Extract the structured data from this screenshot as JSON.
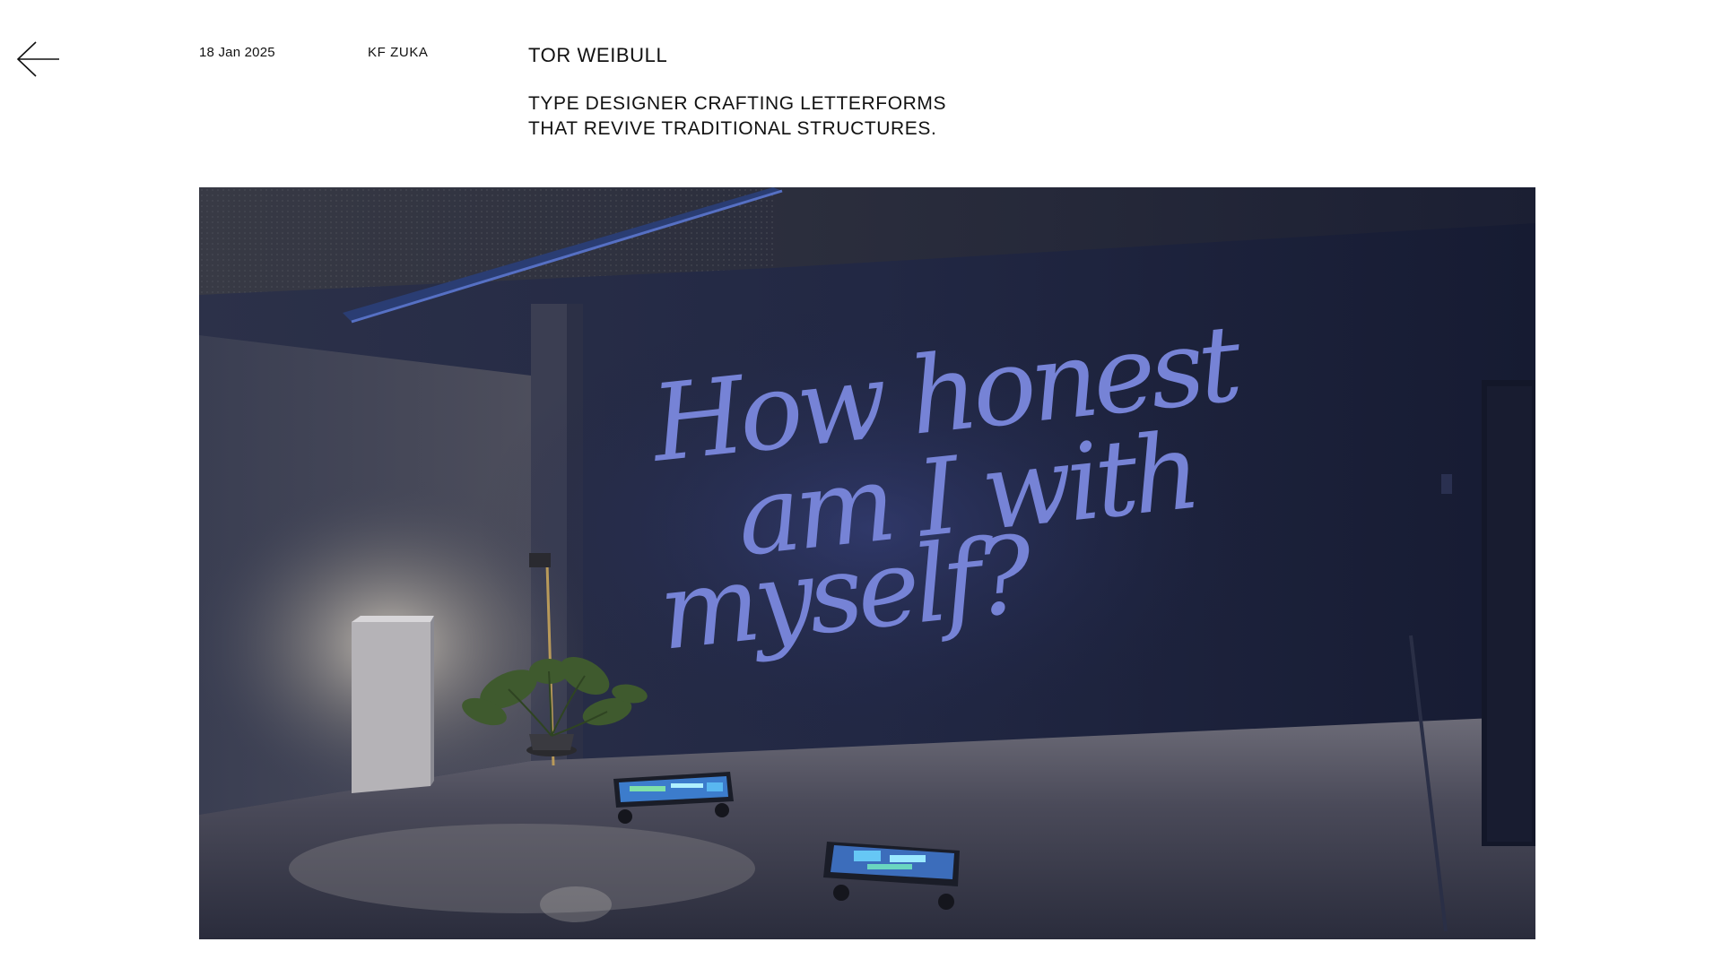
{
  "header": {
    "back_icon": "arrow-left-icon",
    "date": "18 Jan 2025",
    "author": "KF ZUKA",
    "title": "TOR WEIBULL",
    "description_lines": [
      "TYPE DESIGNER CRAFTING LETTERFORMS",
      "THAT REVIVE TRADITIONAL STRUCTURES."
    ]
  },
  "photo": {
    "projection_lines": [
      "How honest",
      "am I with",
      "myself?"
    ],
    "colors": {
      "wall": "#1c2240",
      "projection": "#7683d6",
      "warm_light": "#cfc6b8"
    }
  }
}
